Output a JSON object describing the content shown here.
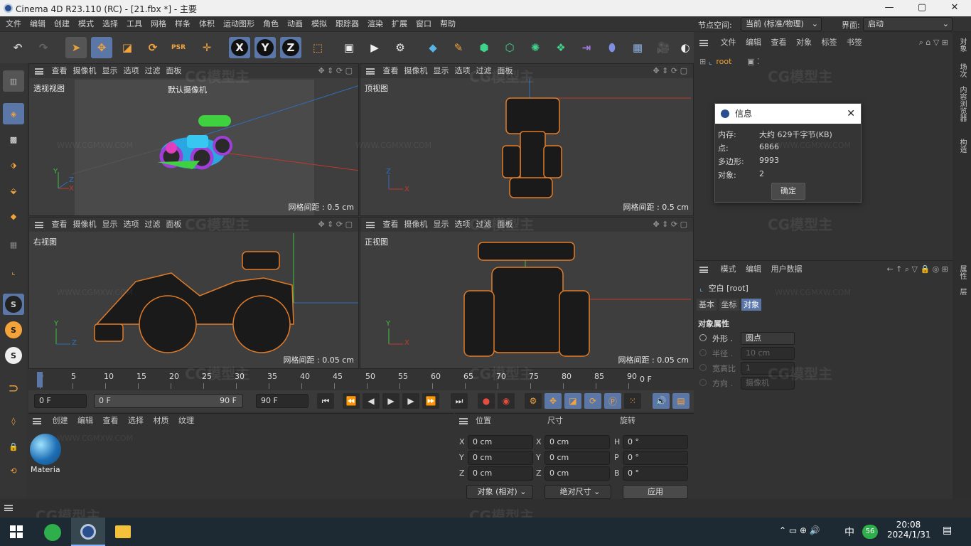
{
  "window": {
    "title": "Cinema 4D R23.110 (RC) - [21.fbx *] - 主要",
    "minimize": "—",
    "maximize": "▢",
    "close": "✕"
  },
  "menu": [
    "文件",
    "编辑",
    "创建",
    "模式",
    "选择",
    "工具",
    "网格",
    "样条",
    "体积",
    "运动图形",
    "角色",
    "动画",
    "模拟",
    "跟踪器",
    "渲染",
    "扩展",
    "窗口",
    "帮助"
  ],
  "node_space": {
    "label": "节点空间:",
    "value": "当前 (标准/物理)"
  },
  "interface": {
    "label": "界面:",
    "value": "启动"
  },
  "toolbar": {
    "x_label": "X",
    "y_label": "Y",
    "z_label": "Z"
  },
  "viewports": [
    {
      "menu": [
        "查看",
        "摄像机",
        "显示",
        "选项",
        "过滤",
        "面板"
      ],
      "name": "透视视图",
      "camera": "默认摄像机",
      "grid": "网格间距 : 0.5 cm"
    },
    {
      "menu": [
        "查看",
        "摄像机",
        "显示",
        "选项",
        "过滤",
        "面板"
      ],
      "name": "顶视图",
      "grid": "网格间距 : 0.5 cm"
    },
    {
      "menu": [
        "查看",
        "摄像机",
        "显示",
        "选项",
        "过滤",
        "面板"
      ],
      "name": "右视图",
      "grid": "网格间距 : 0.05 cm"
    },
    {
      "menu": [
        "查看",
        "摄像机",
        "显示",
        "选项",
        "过滤",
        "面板"
      ],
      "name": "正视图",
      "grid": "网格间距 : 0.05 cm"
    }
  ],
  "axis_labels": {
    "x": "X",
    "y": "Y",
    "z": "Z"
  },
  "timeline": {
    "ticks": [
      "0",
      "5",
      "10",
      "15",
      "20",
      "25",
      "30",
      "35",
      "40",
      "45",
      "50",
      "55",
      "60",
      "65",
      "70",
      "75",
      "80",
      "85",
      "90"
    ],
    "current": "0 F"
  },
  "playbar": {
    "start": "0 F",
    "range_start": "0 F",
    "range_end": "90 F",
    "end": "90 F"
  },
  "material_panel": {
    "menu": [
      "创建",
      "编辑",
      "查看",
      "选择",
      "材质",
      "纹理"
    ],
    "material_name": "Materia"
  },
  "coord_panel": {
    "headers": [
      "位置",
      "尺寸",
      "旋转"
    ],
    "rows": [
      {
        "axis": "X",
        "pos": "0 cm",
        "size_axis": "X",
        "size": "0 cm",
        "rot_axis": "H",
        "rot": "0 °"
      },
      {
        "axis": "Y",
        "pos": "0 cm",
        "size_axis": "Y",
        "size": "0 cm",
        "rot_axis": "P",
        "rot": "0 °"
      },
      {
        "axis": "Z",
        "pos": "0 cm",
        "size_axis": "Z",
        "size": "0 cm",
        "rot_axis": "B",
        "rot": "0 °"
      }
    ],
    "mode": "对象 (相对)",
    "size_mode": "绝对尺寸",
    "apply": "应用"
  },
  "object_panel": {
    "menu": [
      "文件",
      "编辑",
      "查看",
      "对象",
      "标签",
      "书签"
    ],
    "root": "root"
  },
  "attr_panel": {
    "menu": [
      "模式",
      "编辑",
      "用户数据"
    ],
    "title": "空白 [root]",
    "tabs": [
      "基本",
      "坐标",
      "对象"
    ],
    "section": "对象属性",
    "fields": [
      {
        "label": "外形 .",
        "value": "圆点"
      },
      {
        "label": "半径 .",
        "value": "10 cm"
      },
      {
        "label": "宽高比",
        "value": "1"
      },
      {
        "label": "方向 .",
        "value": "摄像机"
      }
    ]
  },
  "side_tabs": [
    "对象",
    "场次",
    "内容浏览器",
    "构造",
    "属性",
    "层"
  ],
  "dialog": {
    "title": "信息",
    "rows": [
      {
        "label": "内存:",
        "value": "大约 629千字节(KB)"
      },
      {
        "label": "点:",
        "value": "6866"
      },
      {
        "label": "多边形:",
        "value": "9993"
      },
      {
        "label": "对象:",
        "value": "2"
      }
    ],
    "ok": "确定"
  },
  "watermark": {
    "text": "CG模型主",
    "url": "WWW.CGMXW.COM"
  },
  "taskbar": {
    "time": "20:08",
    "date": "2024/1/31",
    "ime": "中",
    "badge": "56"
  }
}
